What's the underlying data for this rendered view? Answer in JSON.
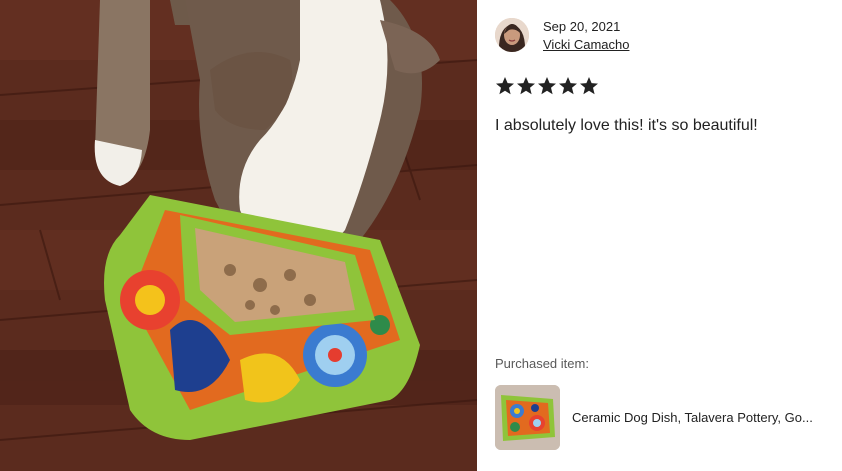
{
  "review": {
    "date": "Sep 20, 2021",
    "reviewer_name": "Vicki Camacho",
    "rating": 5,
    "rating_max": 5,
    "text": "I absolutely love this! it's so beautiful!"
  },
  "purchased": {
    "label": "Purchased item:",
    "product_title": "Ceramic Dog Dish, Talavera Pottery, Go..."
  },
  "icons": {
    "star": "star-filled-icon"
  },
  "colors": {
    "star": "#222222",
    "floor": "#5a2a1d",
    "bowl_green": "#8fc43a"
  }
}
